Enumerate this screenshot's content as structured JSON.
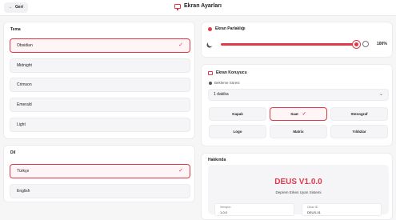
{
  "header": {
    "back_label": "Geri",
    "title": "Ekran Ayarları"
  },
  "theme": {
    "title": "Tema",
    "options": [
      "Obsidian",
      "Midnight",
      "Crimson",
      "Emerald",
      "Light"
    ],
    "selected": "Obsidian"
  },
  "language": {
    "title": "Dil",
    "options": [
      "Türkçe",
      "English"
    ],
    "selected": "Türkçe"
  },
  "brightness": {
    "title": "Ekran Parlaklığı",
    "value": "100%",
    "level": 1.0
  },
  "screensaver": {
    "title": "Ekran Koruyucu",
    "wait_label": "Bekleme Süresi",
    "wait_value": "1 dakika",
    "options": [
      "Kapalı",
      "Saat",
      "Stenograf",
      "Logo",
      "Matrix",
      "Yıldızlar"
    ],
    "selected": "Saat"
  },
  "about": {
    "title": "Hakkında",
    "product": "DEUS V1.0.0",
    "subtitle": "Deprem Erken Uyarı Sistemi",
    "version_label": "Versiyon",
    "version_value": "1.0.0",
    "device_label": "Cihaz ID",
    "device_value": "DEUS-01"
  },
  "colors": {
    "accent": "#e03a4a",
    "background": "#f6f6f7",
    "panel": "#ffffff"
  }
}
